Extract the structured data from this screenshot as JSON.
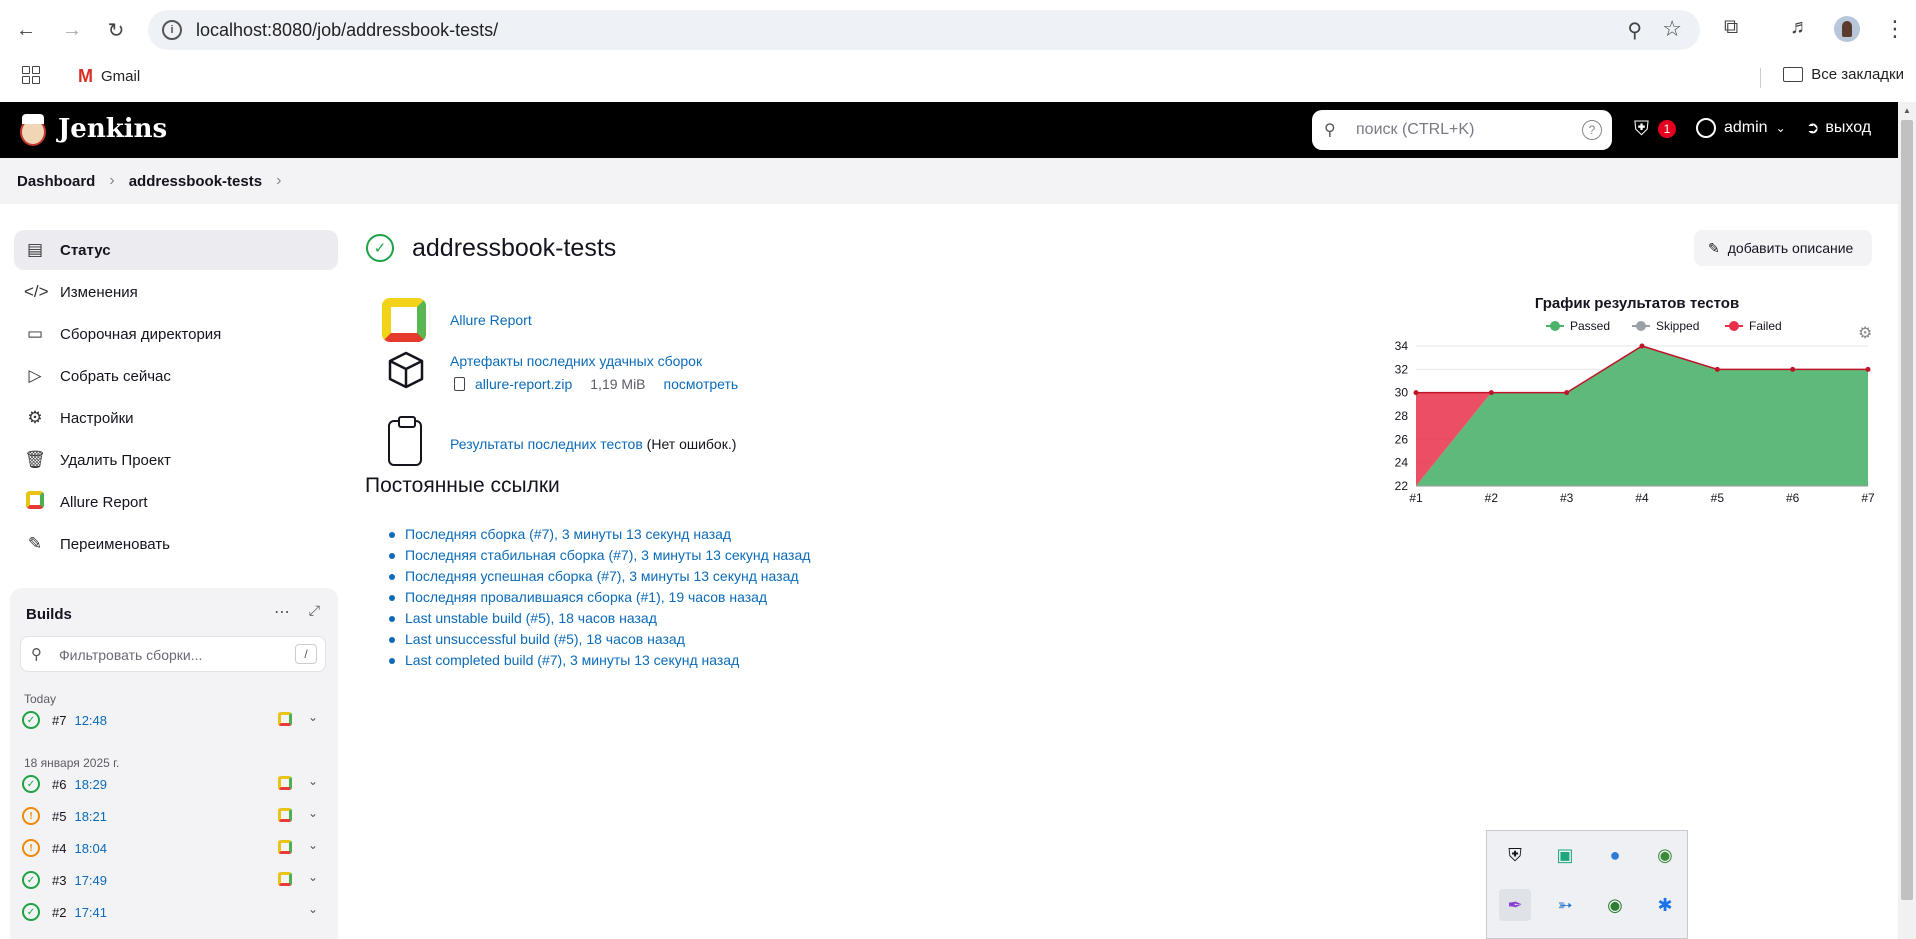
{
  "browser": {
    "url": "localhost:8080/job/addressbook-tests/",
    "bookmark_gmail": "Gmail",
    "all_bookmarks": "Все закладки"
  },
  "header": {
    "app_name": "Jenkins",
    "search_placeholder": "поиск (CTRL+K)",
    "security_count": "1",
    "user": "admin",
    "logout": "выход"
  },
  "breadcrumb": {
    "items": [
      "Dashboard",
      "addressbook-tests"
    ]
  },
  "sidebar": {
    "items": [
      {
        "label": "Статус",
        "icon": "document-icon"
      },
      {
        "label": "Изменения",
        "icon": "code-icon"
      },
      {
        "label": "Сборочная директория",
        "icon": "folder-icon"
      },
      {
        "label": "Собрать сейчас",
        "icon": "play-icon"
      },
      {
        "label": "Настройки",
        "icon": "gear-icon"
      },
      {
        "label": "Удалить Проект",
        "icon": "trash-icon"
      },
      {
        "label": "Allure Report",
        "icon": "allure-icon"
      },
      {
        "label": "Переименовать",
        "icon": "pencil-icon"
      }
    ]
  },
  "builds": {
    "title": "Builds",
    "filter_placeholder": "Фильтровать сборки...",
    "filter_shortcut": "/",
    "today_label": "Today",
    "date_label": "18 января 2025 г.",
    "rows": [
      {
        "num": "#7",
        "time": "12:48",
        "status": "success",
        "allure": true
      },
      {
        "num": "#6",
        "time": "18:29",
        "status": "success",
        "allure": true
      },
      {
        "num": "#5",
        "time": "18:21",
        "status": "unstable",
        "allure": true
      },
      {
        "num": "#4",
        "time": "18:04",
        "status": "unstable",
        "allure": true
      },
      {
        "num": "#3",
        "time": "17:49",
        "status": "success",
        "allure": true
      },
      {
        "num": "#2",
        "time": "17:41",
        "status": "success",
        "allure": false
      }
    ]
  },
  "main": {
    "title": "addressbook-tests",
    "add_description": "добавить описание",
    "allure_link": "Allure Report",
    "artifacts_link": "Артефакты последних удачных сборок",
    "artifact_file": "allure-report.zip",
    "artifact_size": "1,19 MiB",
    "artifact_view": "посмотреть",
    "test_results_link": "Результаты последних тестов",
    "test_results_note": "(Нет ошибок.)",
    "permalinks_title": "Постоянные ссылки",
    "permalinks": [
      "Последняя сборка (#7), 3 минуты 13 секунд назад",
      "Последняя стабильная сборка (#7), 3 минуты 13 секунд назад",
      "Последняя успешная сборка (#7), 3 минуты 13 секунд назад",
      "Последняя провалившаяся сборка (#1), 19 часов назад",
      "Last unstable build (#5), 18 часов назад",
      "Last unsuccessful build (#5), 18 часов назад",
      "Last completed build (#7), 3 минуты 13 секунд назад"
    ]
  },
  "chart_data": {
    "type": "area",
    "title": "График результатов тестов",
    "categories": [
      "#1",
      "#2",
      "#3",
      "#4",
      "#5",
      "#6",
      "#7"
    ],
    "series": [
      {
        "name": "Passed",
        "color": "#4cb36b",
        "values": [
          22,
          30,
          30,
          34,
          32,
          32,
          32
        ]
      },
      {
        "name": "Skipped",
        "color": "#9aa0a6",
        "values": [
          0,
          0,
          0,
          0,
          0,
          0,
          0
        ]
      },
      {
        "name": "Failed",
        "color": "#e8304a",
        "values": [
          30,
          30,
          30,
          34,
          32,
          32,
          32
        ]
      }
    ],
    "ylim": [
      22,
      34
    ],
    "yticks": [
      22,
      24,
      26,
      28,
      30,
      32,
      34
    ],
    "legend_position": "top",
    "grid": true
  }
}
